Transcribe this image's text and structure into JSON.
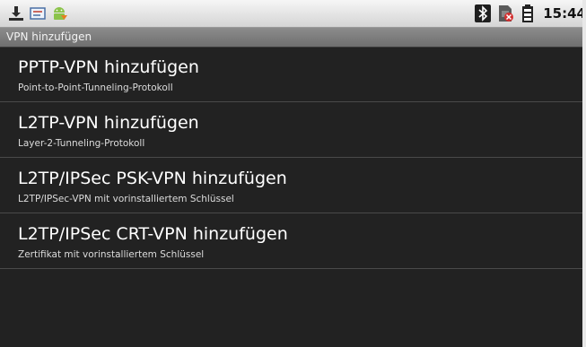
{
  "status_bar": {
    "left_icons": [
      "download-icon",
      "message-icon",
      "android-debug-icon"
    ],
    "right_icons": [
      "bluetooth-icon",
      "no-sim-icon",
      "battery-icon"
    ],
    "time": "15:44"
  },
  "title_bar": {
    "title": "VPN hinzufügen"
  },
  "list": {
    "items": [
      {
        "label": "PPTP-VPN hinzufügen",
        "sublabel": "Point-to-Point-Tunneling-Protokoll"
      },
      {
        "label": "L2TP-VPN hinzufügen",
        "sublabel": "Layer-2-Tunneling-Protokoll"
      },
      {
        "label": "L2TP/IPSec PSK-VPN hinzufügen",
        "sublabel": "L2TP/IPSec-VPN mit vorinstalliertem Schlüssel"
      },
      {
        "label": "L2TP/IPSec CRT-VPN hinzufügen",
        "sublabel": "Zertifikat mit vorinstalliertem Schlüssel"
      }
    ]
  },
  "colors": {
    "list_background": "#222222",
    "title_bar": "#7e7e7e",
    "status_bar": "#e6e6e6"
  }
}
